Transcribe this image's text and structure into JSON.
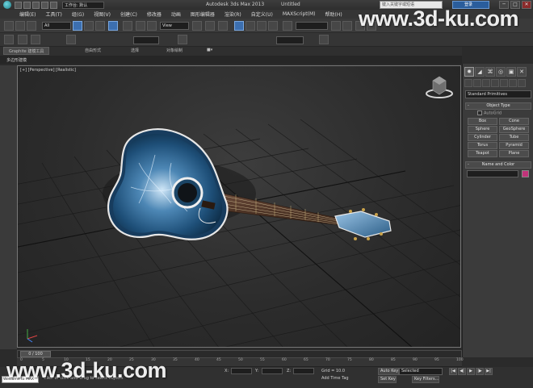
{
  "titlebar": {
    "workspace": "工作台: 默认",
    "app_title": "Autodesk 3ds Max 2013",
    "file_name": "Untitled",
    "search_placeholder": "键入关键字或短语",
    "sign_in": "登录",
    "minimize": "─",
    "maximize": "□",
    "close": "✕"
  },
  "menu": [
    "编辑(E)",
    "工具(T)",
    "组(G)",
    "视图(V)",
    "创建(C)",
    "修改器",
    "动画",
    "图形编辑器",
    "渲染(R)",
    "自定义(U)",
    "MAXScript(M)",
    "帮助(H)"
  ],
  "toolbar": {
    "selection_filter": "All",
    "reference_coord": "View"
  },
  "ribbon": {
    "tabs": [
      "Graphite 建模工具",
      "自由形式",
      "选择",
      "对象绘制"
    ],
    "subtitle": "多边形建模"
  },
  "viewport": {
    "label": "[+] [Perspective] [Realistic]"
  },
  "command_panel": {
    "category": "Standard Primitives",
    "object_type_title": "Object Type",
    "autogrid": "AutoGrid",
    "primitives": [
      "Box",
      "Cone",
      "Sphere",
      "GeoSphere",
      "Cylinder",
      "Tube",
      "Torus",
      "Pyramid",
      "Teapot",
      "Plane"
    ],
    "name_color_title": "Name and Color",
    "object_color": "#c2337a"
  },
  "timeline": {
    "slider": "0 / 100",
    "ticks": [
      "0",
      "5",
      "10",
      "15",
      "20",
      "25",
      "30",
      "35",
      "40",
      "45",
      "50",
      "55",
      "60",
      "65",
      "70",
      "75",
      "80",
      "85",
      "90",
      "95",
      "100"
    ]
  },
  "statusbar": {
    "maxscript": "Welcome to MAX",
    "prompt": "Click or click-and-drag to select objects",
    "x_label": "X:",
    "y_label": "Y:",
    "z_label": "Z:",
    "grid": "Grid = 10.0",
    "add_time_tag": "Add Time Tag",
    "auto_key": "Auto Key",
    "set_key": "Set Key",
    "selected": "Selected",
    "key_filters": "Key Filters..."
  },
  "watermark": "www.3d-ku.com"
}
